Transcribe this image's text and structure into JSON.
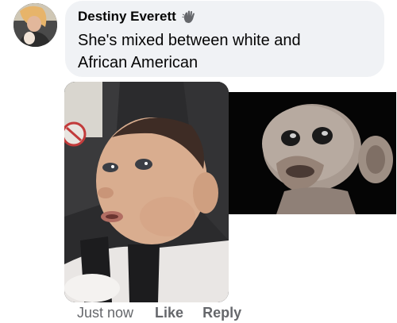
{
  "comment": {
    "author": "Destiny Everett",
    "text_line1": "She's mixed between white and",
    "text_line2": "African American"
  },
  "actions": {
    "time": "Just now",
    "like": "Like",
    "reply": "Reply"
  },
  "icons": {
    "author_badge": "wave-hand-icon"
  },
  "colors": {
    "bubble_bg": "#f0f2f5",
    "action_text": "#65676b"
  }
}
